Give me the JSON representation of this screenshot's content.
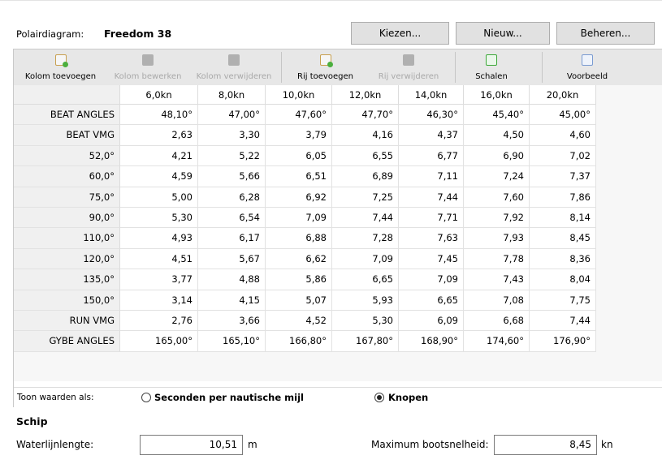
{
  "header": {
    "polar_label": "Polairdiagram:",
    "boat_name": "Freedom 38",
    "buttons": {
      "choose": "Kiezen...",
      "new": "Nieuw...",
      "manage": "Beheren..."
    }
  },
  "toolbar": {
    "add_column": "Kolom toevoegen",
    "edit_column": "Kolom bewerken",
    "delete_column": "Kolom verwijderen",
    "add_row": "Rij toevoegen",
    "delete_row": "Rij verwijderen",
    "scale": "Schalen",
    "preview": "Voorbeeld"
  },
  "table": {
    "columns": [
      "6,0kn",
      "8,0kn",
      "10,0kn",
      "12,0kn",
      "14,0kn",
      "16,0kn",
      "20,0kn"
    ],
    "rows": [
      {
        "label": "BEAT ANGLES",
        "values": [
          "48,10°",
          "47,00°",
          "47,60°",
          "47,70°",
          "46,30°",
          "45,40°",
          "45,00°"
        ]
      },
      {
        "label": "BEAT VMG",
        "values": [
          "2,63",
          "3,30",
          "3,79",
          "4,16",
          "4,37",
          "4,50",
          "4,60"
        ]
      },
      {
        "label": "52,0°",
        "values": [
          "4,21",
          "5,22",
          "6,05",
          "6,55",
          "6,77",
          "6,90",
          "7,02"
        ]
      },
      {
        "label": "60,0°",
        "values": [
          "4,59",
          "5,66",
          "6,51",
          "6,89",
          "7,11",
          "7,24",
          "7,37"
        ]
      },
      {
        "label": "75,0°",
        "values": [
          "5,00",
          "6,28",
          "6,92",
          "7,25",
          "7,44",
          "7,60",
          "7,86"
        ]
      },
      {
        "label": "90,0°",
        "values": [
          "5,30",
          "6,54",
          "7,09",
          "7,44",
          "7,71",
          "7,92",
          "8,14"
        ]
      },
      {
        "label": "110,0°",
        "values": [
          "4,93",
          "6,17",
          "6,88",
          "7,28",
          "7,63",
          "7,93",
          "8,45"
        ]
      },
      {
        "label": "120,0°",
        "values": [
          "4,51",
          "5,67",
          "6,62",
          "7,09",
          "7,45",
          "7,78",
          "8,36"
        ]
      },
      {
        "label": "135,0°",
        "values": [
          "3,77",
          "4,88",
          "5,86",
          "6,65",
          "7,09",
          "7,43",
          "8,04"
        ]
      },
      {
        "label": "150,0°",
        "values": [
          "3,14",
          "4,15",
          "5,07",
          "5,93",
          "6,65",
          "7,08",
          "7,75"
        ]
      },
      {
        "label": "RUN VMG",
        "values": [
          "2,76",
          "3,66",
          "4,52",
          "5,30",
          "6,09",
          "6,68",
          "7,44"
        ]
      },
      {
        "label": "GYBE ANGLES",
        "values": [
          "165,00°",
          "165,10°",
          "166,80°",
          "167,80°",
          "168,90°",
          "174,60°",
          "176,90°"
        ]
      }
    ]
  },
  "display": {
    "label": "Toon waarden als:",
    "option_seconds": "Seconden per nautische mijl",
    "option_knots": "Knopen",
    "selected": "Knopen"
  },
  "ship": {
    "section_title": "Schip",
    "waterline_label": "Waterlijnlengte:",
    "waterline_value": "10,51",
    "waterline_unit": "m",
    "max_speed_label": "Maximum bootsnelheid:",
    "max_speed_value": "8,45",
    "max_speed_unit": "kn"
  }
}
